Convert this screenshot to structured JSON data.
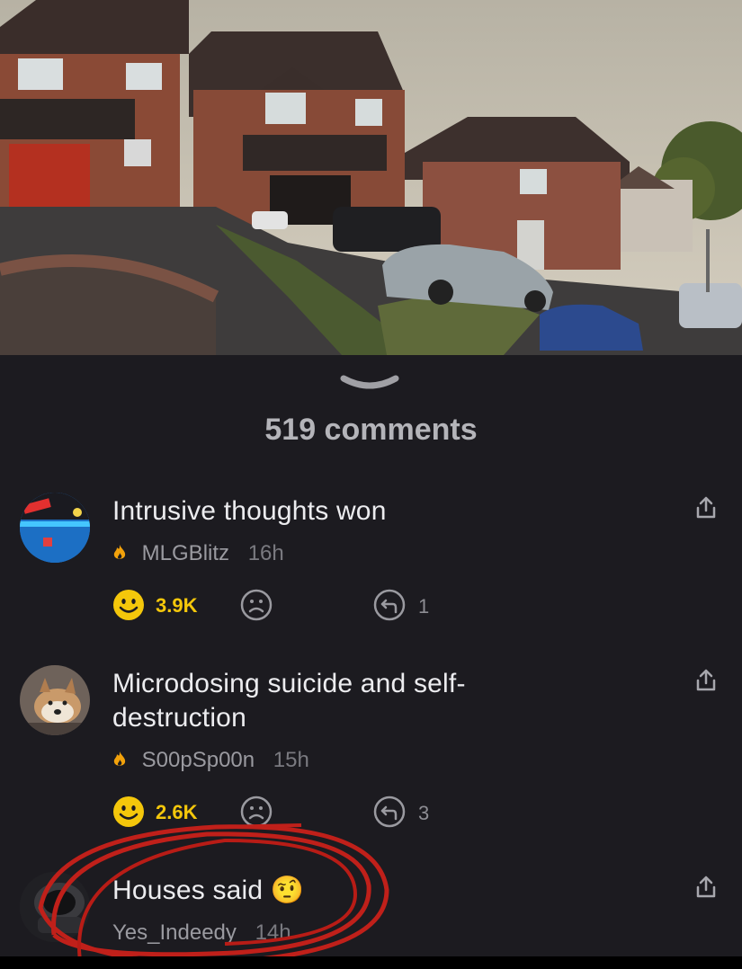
{
  "video": {
    "description_icon": "video-frame"
  },
  "comments_header": {
    "count_label": "519 comments"
  },
  "comments": [
    {
      "text": "Intrusive thoughts won",
      "user": "MLGBlitz",
      "time": "16h",
      "likes": "3.9K",
      "replies": "1"
    },
    {
      "text": "Microdosing suicide and self-destruction",
      "user": "S00pSp00n",
      "time": "15h",
      "likes": "2.6K",
      "replies": "3"
    },
    {
      "text": "Houses said 🤨",
      "user": "Yes_Indeedy",
      "time": "14h"
    }
  ],
  "colors": {
    "background": "#1c1b20",
    "likes": "#f4c70b",
    "annotation": "#c0201a"
  }
}
